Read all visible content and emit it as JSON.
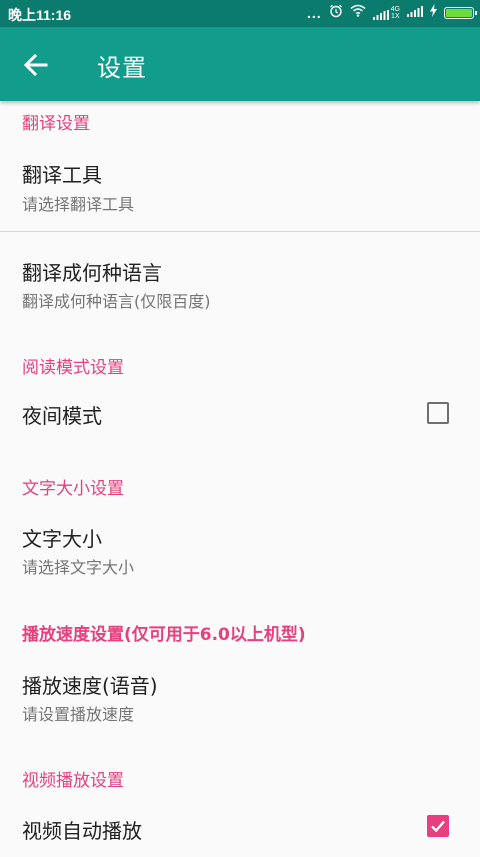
{
  "status_bar": {
    "time": "晚上11:16",
    "dots": "...",
    "network_tiny_top": "4G",
    "network_tiny_bottom": "1X"
  },
  "app_bar": {
    "title": "设置"
  },
  "settings": {
    "translation_section": "翻译设置",
    "translation_tool": {
      "title": "翻译工具",
      "summary": "请选择翻译工具"
    },
    "target_language": {
      "title": "翻译成何种语言",
      "summary": "翻译成何种语言(仅限百度)"
    },
    "reading_section": "阅读模式设置",
    "night_mode": {
      "title": "夜间模式",
      "checked": false
    },
    "text_size_section": "文字大小设置",
    "text_size": {
      "title": "文字大小",
      "summary": "请选择文字大小"
    },
    "playback_section": "播放速度设置(仅可用于6.0以上机型)",
    "playback_speed": {
      "title": "播放速度(语音)",
      "summary": "请设置播放速度"
    },
    "video_section": "视频播放设置",
    "video_autoplay": {
      "title": "视频自动播放",
      "checked": true
    }
  },
  "colors": {
    "status_bar": "#0b7b6e",
    "app_bar": "#129c8c",
    "accent": "#e6407f"
  }
}
